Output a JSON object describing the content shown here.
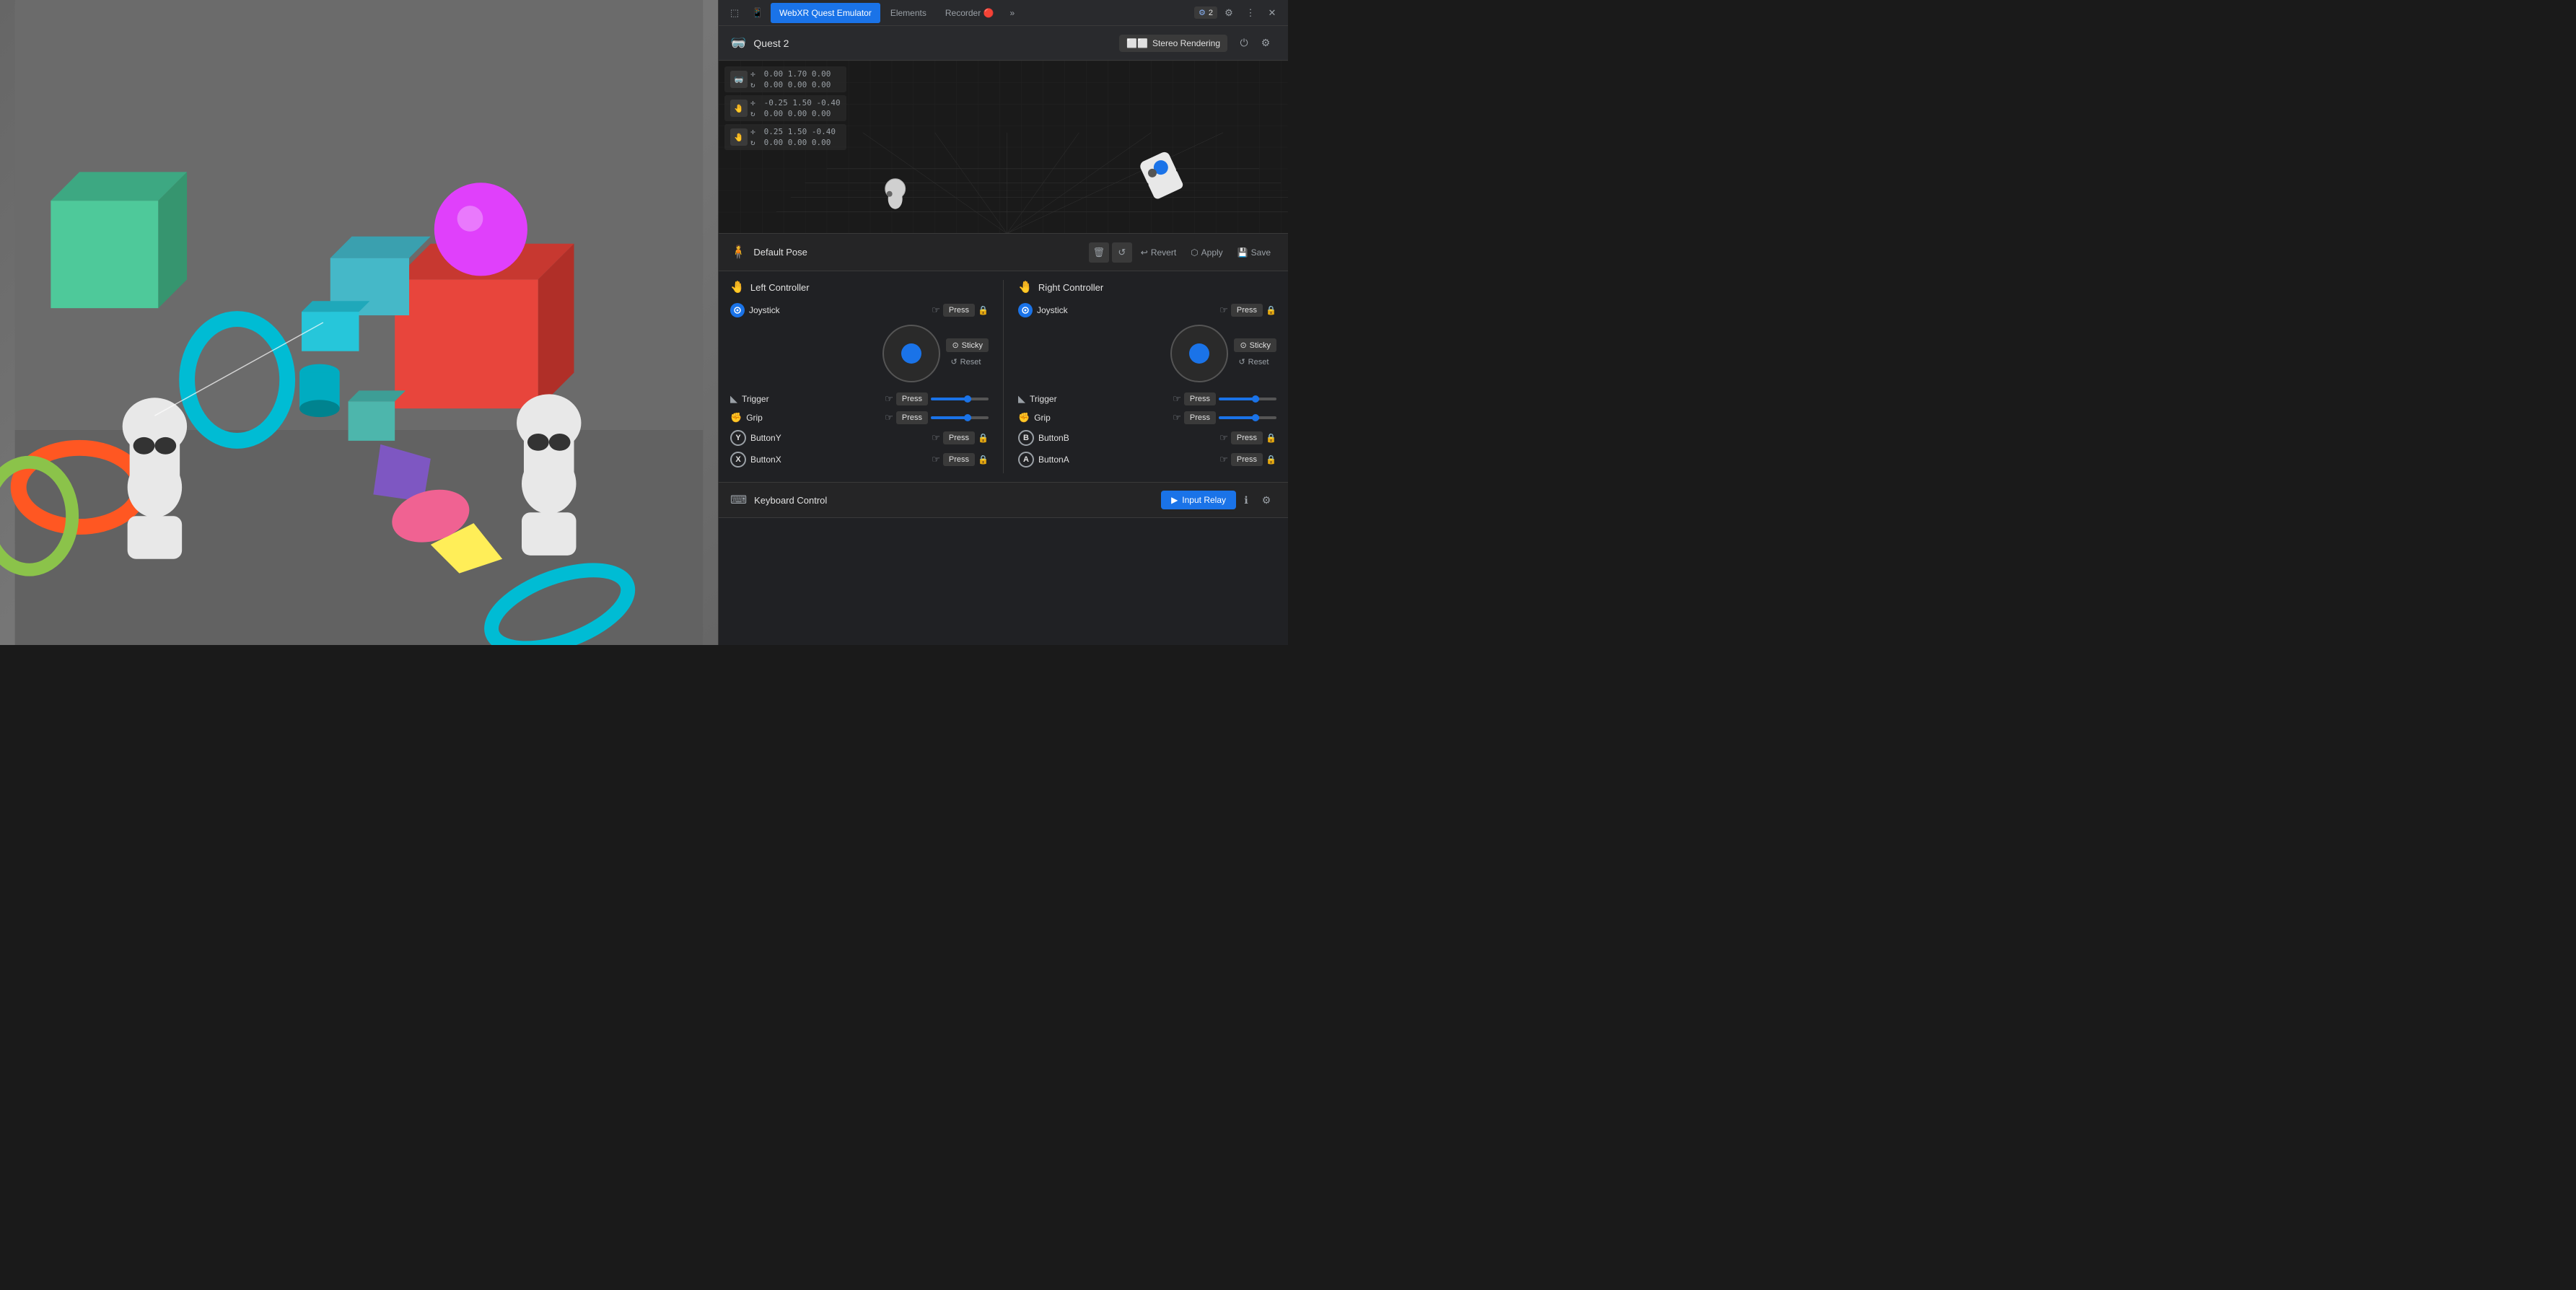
{
  "devtools": {
    "tabs": [
      {
        "label": "WebXR Quest Emulator",
        "active": true
      },
      {
        "label": "Elements",
        "active": false
      },
      {
        "label": "Recorder 🔴",
        "active": false
      },
      {
        "label": "»",
        "active": false
      }
    ],
    "badge": "2"
  },
  "webxr": {
    "headset_name": "Quest 2",
    "stereo_label": "Stereo Rendering",
    "transforms": [
      {
        "pos": "0.00  1.70  0.00",
        "rot": "0.00  0.00  0.00"
      },
      {
        "pos": "-0.25  1.50  -0.40",
        "rot": "0.00  0.00  0.00"
      },
      {
        "pos": "0.25  1.50  -0.40",
        "rot": "0.00  0.00  0.00"
      }
    ],
    "pose": {
      "name": "Default Pose",
      "revert_label": "Revert",
      "apply_label": "Apply",
      "save_label": "Save"
    },
    "left_controller": {
      "label": "Left Controller",
      "joystick_label": "Joystick",
      "joystick_press": "Press",
      "sticky_label": "Sticky",
      "reset_label": "Reset",
      "trigger_label": "Trigger",
      "trigger_press": "Press",
      "grip_label": "Grip",
      "grip_press": "Press",
      "buttonY_label": "ButtonY",
      "buttonY_press": "Press",
      "buttonX_label": "ButtonX",
      "buttonX_press": "Press"
    },
    "right_controller": {
      "label": "Right Controller",
      "joystick_label": "Joystick",
      "joystick_press": "Press",
      "sticky_label": "Sticky",
      "reset_label": "Reset",
      "trigger_label": "Trigger",
      "trigger_press": "Press",
      "grip_label": "Grip",
      "grip_press": "Press",
      "buttonB_label": "ButtonB",
      "buttonB_press": "Press",
      "buttonA_label": "ButtonA",
      "buttonA_press": "Press"
    },
    "keyboard": {
      "label": "Keyboard Control",
      "input_relay_label": "Input Relay"
    }
  }
}
